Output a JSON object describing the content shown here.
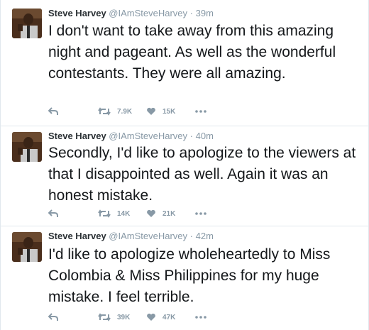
{
  "colors": {
    "text": "#14171a",
    "muted": "#8899a6",
    "border": "#e1e8ed",
    "avatar_bg": "#5a3a22"
  },
  "tweets": [
    {
      "fullname": "Steve Harvey",
      "handle": "@IAmSteveHarvey",
      "separator": "·",
      "time": "39m",
      "text": "I don't want to take away from this amazing night and pageant. As well as the wonderful contestants. They were all amazing.",
      "retweets": "7.9K",
      "likes": "15K",
      "icons": [
        "reply-icon",
        "retweet-icon",
        "heart-icon",
        "more-icon"
      ]
    },
    {
      "fullname": "Steve Harvey",
      "handle": "@IAmSteveHarvey",
      "separator": "·",
      "time": "40m",
      "text": "Secondly, I'd like to apologize to the viewers at that I disappointed as well. Again it was an honest mistake.",
      "retweets": "14K",
      "likes": "21K",
      "icons": [
        "reply-icon",
        "retweet-icon",
        "heart-icon",
        "more-icon"
      ]
    },
    {
      "fullname": "Steve Harvey",
      "handle": "@IAmSteveHarvey",
      "separator": "·",
      "time": "42m",
      "text": "I'd like to apologize wholeheartedly to Miss Colombia & Miss Philippines for my huge mistake. I feel terrible.",
      "retweets": "39K",
      "likes": "47K",
      "icons": [
        "reply-icon",
        "retweet-icon",
        "heart-icon",
        "more-icon"
      ]
    }
  ]
}
